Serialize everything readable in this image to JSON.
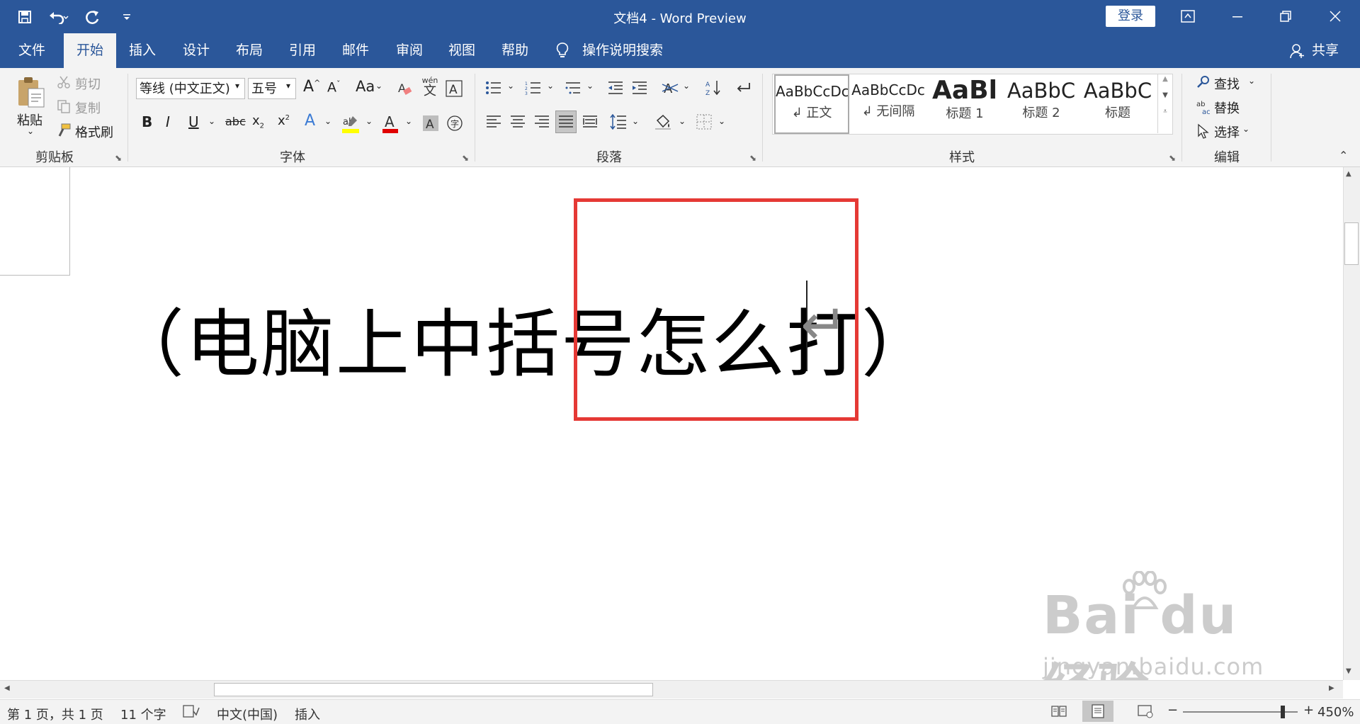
{
  "window": {
    "title": "文档4 - Word Preview",
    "login_label": "登录",
    "share_label": "共享"
  },
  "tabs": [
    "文件",
    "开始",
    "插入",
    "设计",
    "布局",
    "引用",
    "邮件",
    "审阅",
    "视图",
    "帮助"
  ],
  "tell_me": "操作说明搜索",
  "clipboard": {
    "paste_label": "粘贴",
    "cut_label": "剪切",
    "copy_label": "复制",
    "format_painter_label": "格式刷",
    "group_label": "剪贴板"
  },
  "font": {
    "family": "等线 (中文正文)",
    "size": "五号",
    "case_label": "Aa",
    "group_label": "字体",
    "phonetic_top": "wén",
    "phonetic_bottom": "文"
  },
  "paragraph": {
    "group_label": "段落"
  },
  "styles": {
    "group_label": "样式",
    "items": [
      {
        "preview": "AaBbCcDc",
        "label": "↲ 正文"
      },
      {
        "preview": "AaBbCcDc",
        "label": "↲ 无间隔"
      },
      {
        "preview": "AaBl",
        "label": "标题 1"
      },
      {
        "preview": "AaBbC",
        "label": "标题 2"
      },
      {
        "preview": "AaBbC",
        "label": "标题"
      }
    ]
  },
  "editing": {
    "find_label": "查找",
    "replace_label": "替换",
    "select_label": "选择",
    "group_label": "编辑"
  },
  "document": {
    "text": "（电脑上中括号怎么打）"
  },
  "watermark": {
    "main": "Bai  du 经验",
    "url": "jingyan.baidu.com"
  },
  "status": {
    "page": "第 1 页，共 1 页",
    "words": "11 个字",
    "language": "中文(中国)",
    "mode": "插入",
    "zoom": "450%"
  },
  "colors": {
    "accent": "#2b579a",
    "highlight_box": "#e53935",
    "font_color": "#e00000",
    "highlight_color": "#ffff00"
  }
}
